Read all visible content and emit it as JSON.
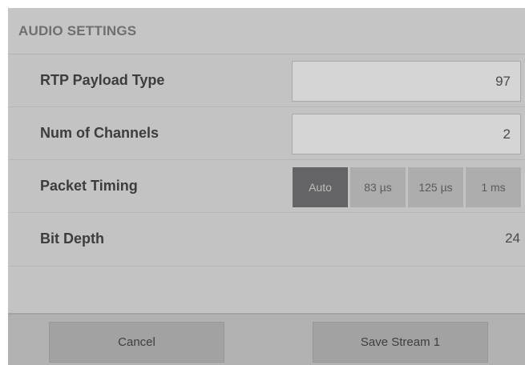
{
  "header": {
    "title": "AUDIO SETTINGS"
  },
  "settings": {
    "rtp_payload_type": {
      "label": "RTP Payload Type",
      "value": "97"
    },
    "num_channels": {
      "label": "Num of Channels",
      "value": "2"
    },
    "packet_timing": {
      "label": "Packet Timing",
      "options": [
        "Auto",
        "83 µs",
        "125 µs",
        "1 ms"
      ],
      "selected": "Auto"
    },
    "bit_depth": {
      "label": "Bit Depth",
      "value": "24"
    }
  },
  "footer": {
    "cancel_label": "Cancel",
    "save_label": "Save Stream 1"
  },
  "colors": {
    "panel_bg": "#c3c3c3",
    "field_bg": "#d5d5d5",
    "segment_active": "#646466",
    "segment_inactive": "#adadad",
    "button_bg": "#a2a2a2"
  }
}
